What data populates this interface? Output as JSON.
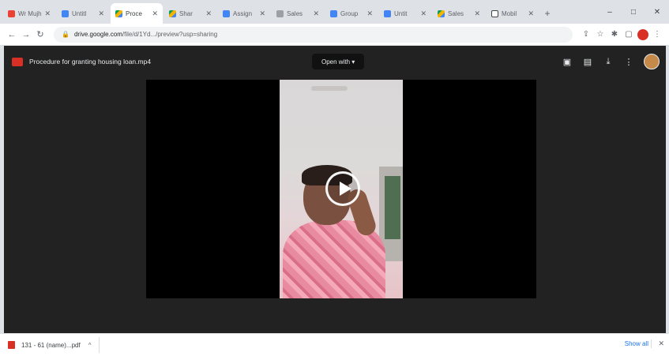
{
  "browser": {
    "tabs": [
      {
        "label": "Wr Mujh",
        "icon": "gmail-icon",
        "active": false
      },
      {
        "label": "Untitl",
        "icon": "docs-icon",
        "active": false
      },
      {
        "label": "Proce",
        "icon": "drive-icon",
        "active": true
      },
      {
        "label": "Shar",
        "icon": "drive-icon",
        "active": false
      },
      {
        "label": "Assign",
        "icon": "docs-icon",
        "active": false
      },
      {
        "label": "Sales",
        "icon": "page-icon",
        "active": false
      },
      {
        "label": "Group",
        "icon": "docs-icon",
        "active": false
      },
      {
        "label": "Untit",
        "icon": "docs-icon",
        "active": false
      },
      {
        "label": "Sales",
        "icon": "drive-icon",
        "active": false
      },
      {
        "label": "Mobil",
        "icon": "notion-icon",
        "active": false
      }
    ],
    "new_tab": "+",
    "window_controls": {
      "minimize": "–",
      "maximize": "□",
      "close": "✕"
    },
    "address": {
      "host": "drive.google.com",
      "path": "/file/d/1Yd.../preview?usp=sharing"
    }
  },
  "viewer": {
    "file_name": "Procedure for granting housing loan.mp4",
    "open_with_label": "Open with ▾"
  },
  "download_shelf": {
    "file_label": "131 - 61 (name)...pdf",
    "show_all_label": "Show all",
    "close_label": "✕"
  }
}
